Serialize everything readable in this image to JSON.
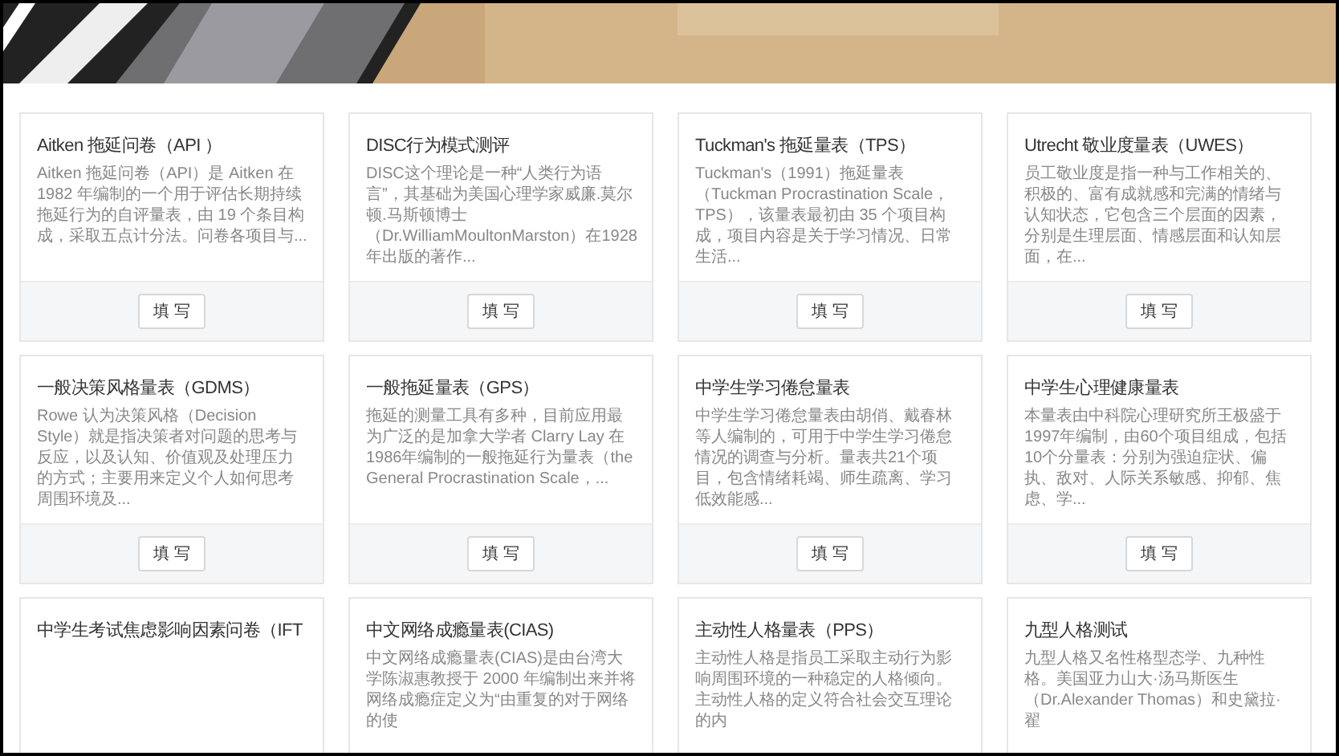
{
  "cards": [
    {
      "title": "Aitken 拖延问卷（API ）",
      "description": "Aitken 拖延问卷（API）是 Aitken 在 1982 年编制的一个用于评估长期持续拖延行为的自评量表，由 19 个条目构成，采取五点计分法。问卷各项目与...",
      "button": "填 写"
    },
    {
      "title": "DISC行为模式测评",
      "description": "DISC这个理论是一种“人类行为语言”，其基础为美国心理学家威廉.莫尔顿.马斯顿博士（Dr.WilliamMoultonMarston）在1928年出版的著作...",
      "button": "填 写"
    },
    {
      "title": "Tuckman's 拖延量表（TPS）",
      "description": "Tuckman's（1991）拖延量表（Tuckman Procrastination Scale，TPS），该量表最初由 35 个项目构成，项目内容是关于学习情况、日常生活...",
      "button": "填 写"
    },
    {
      "title": "Utrecht 敬业度量表（UWES）",
      "description": "员工敬业度是指一种与工作相关的、积极的、富有成就感和完满的情绪与认知状态，它包含三个层面的因素，分别是生理层面、情感层面和认知层面，在...",
      "button": "填 写"
    },
    {
      "title": "一般决策风格量表（GDMS）",
      "description": "Rowe 认为决策风格（Decision Style）就是指决策者对问题的思考与反应，以及认知、价值观及处理压力的方式；主要用来定义个人如何思考周围环境及...",
      "button": "填 写"
    },
    {
      "title": "一般拖延量表（GPS）",
      "description": "拖延的测量工具有多种，目前应用最为广泛的是加拿大学者 Clarry Lay 在1986年编制的一般拖延行为量表（the General Procrastination Scale，...",
      "button": "填 写"
    },
    {
      "title": "中学生学习倦怠量表",
      "description": "中学生学习倦怠量表由胡俏、戴春林等人编制的，可用于中学生学习倦怠情况的调查与分析。量表共21个项目，包含情绪耗竭、师生疏离、学习低效能感...",
      "button": "填 写"
    },
    {
      "title": "中学生心理健康量表",
      "description": "本量表由中科院心理研究所王极盛于1997年编制，由60个项目组成，包括10个分量表：分别为强迫症状、偏执、敌对、人际关系敏感、抑郁、焦虑、学...",
      "button": "填 写"
    },
    {
      "title": "中学生考试焦虑影响因素问卷（IFT"
    },
    {
      "title": "中文网络成瘾量表(CIAS)",
      "description": "中文网络成瘾量表(CIAS)是由台湾大学陈淑惠教授于 2000 年编制出来并将网络成瘾症定义为“由重复的对于网络的使"
    },
    {
      "title": "主动性人格量表（PPS）",
      "description": "主动性人格是指员工采取主动行为影响周围环境的一种稳定的人格倾向。主动性人格的定义符合社会交互理论的内"
    },
    {
      "title": "九型人格测试",
      "description": "九型人格又名性格型态学、九种性格。美国亚力山大·汤马斯医生（Dr.Alexander Thomas）和史黛拉·翟"
    }
  ]
}
